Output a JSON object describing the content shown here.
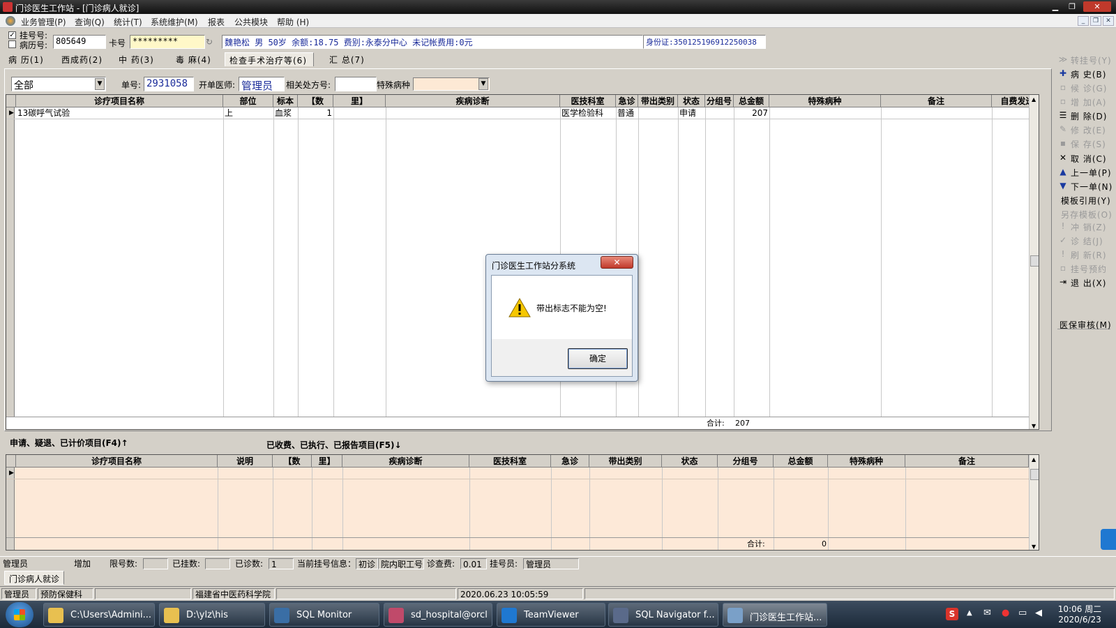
{
  "window": {
    "title": "门诊医生工作站 - [门诊病人就诊]"
  },
  "menu": [
    "业务管理(P)",
    "查询(Q)",
    "统计(T)",
    "系统维护(M)",
    "报表",
    "公共模块",
    "帮助 (H)"
  ],
  "patient": {
    "reg_label": "挂号号:",
    "record_label": "病历号:",
    "reg_value": "805649",
    "card_label": "卡号",
    "card_value": "*********",
    "info": "魏艳松 男 50岁 余额:18.75 费别:永泰分中心 未记帐费用:0元",
    "id_card": "身份证:350125196912250038"
  },
  "tabs": [
    "病 历(1)",
    "西成药(2)",
    "中 药(3)",
    "毒 麻(4)",
    "检查手术治疗等(6)",
    "汇 总(7)"
  ],
  "filter": {
    "category": "全部",
    "order_label": "单号:",
    "order_value": "2931058",
    "doctor_label": "开单医师:",
    "doctor_value": "管理员",
    "rx_label": "相关处方号:",
    "disease_label": "特殊病种"
  },
  "top_grid": {
    "headers": [
      "诊疗项目名称",
      "部位",
      "标本",
      "【数",
      "里】",
      "疾病诊断",
      "医技科室",
      "急诊",
      "带出类别",
      "状态",
      "分组号",
      "总金额",
      "特殊病种",
      "备注",
      "自费发送"
    ],
    "row": [
      "13碳呼气试验",
      "上",
      "血浆",
      "1",
      "",
      "",
      "医学检验科",
      "普通",
      "",
      "申请",
      "",
      "207",
      "",
      "",
      ""
    ],
    "total_label": "合计:",
    "total_value": "207"
  },
  "sections": {
    "top": "申请、疑退、已计价项目(F4)↑",
    "bottom": "已收费、已执行、已报告项目(F5)↓"
  },
  "bottom_grid": {
    "headers": [
      "诊疗项目名称",
      "说明",
      "【数",
      "里】",
      "疾病诊断",
      "医技科室",
      "急诊",
      "带出类别",
      "状态",
      "分组号",
      "总金额",
      "特殊病种",
      "备注"
    ],
    "total_label": "合计:",
    "total_value": "0"
  },
  "side_buttons": [
    {
      "label": "转挂号(Y)",
      "icon": "≫",
      "enabled": false
    },
    {
      "label": "病  史(B)",
      "icon": "✚",
      "enabled": true
    },
    {
      "label": "候  诊(G)",
      "icon": "▫",
      "enabled": false
    },
    {
      "label": "增  加(A)",
      "icon": "▫",
      "enabled": false
    },
    {
      "label": "删  除(D)",
      "icon": "☰",
      "enabled": true
    },
    {
      "label": "修  改(E)",
      "icon": "✎",
      "enabled": false
    },
    {
      "label": "保  存(S)",
      "icon": "▪",
      "enabled": false
    },
    {
      "label": "取  消(C)",
      "icon": "✕",
      "enabled": true
    },
    {
      "label": "上一单(P)",
      "icon": "▲",
      "enabled": true
    },
    {
      "label": "下一单(N)",
      "icon": "▼",
      "enabled": true
    },
    {
      "label": "模板引用(Y)",
      "icon": "",
      "enabled": true
    },
    {
      "label": "另存模板(O)",
      "icon": "",
      "enabled": false
    },
    {
      "label": "冲  销(Z)",
      "icon": "!",
      "enabled": false
    },
    {
      "label": "诊  结(J)",
      "icon": "✓",
      "enabled": false
    },
    {
      "label": "刷  新(R)",
      "icon": "!",
      "enabled": false
    },
    {
      "label": "挂号预约",
      "icon": "▫",
      "enabled": false
    },
    {
      "label": "退  出(X)",
      "icon": "⇥",
      "enabled": true
    }
  ],
  "side_extra": "医保审核(M)",
  "status1": {
    "user": "管理员",
    "mode": "增加",
    "limit_label": "限号数:",
    "limit": "",
    "registered_label": "已挂数:",
    "registered": "",
    "visited_label": "已诊数:",
    "visited": "1",
    "current_label": "当前挂号信息：",
    "visit_type": "初诊",
    "staff": "院内职工号",
    "fee_label": "诊查费:",
    "fee": "0.01",
    "registrar_label": "挂号员:",
    "registrar": "管理员"
  },
  "window_tab": "门诊病人就诊",
  "status2": {
    "user": "管理员",
    "dept": "预防保健科",
    "org": "福建省中医药科学院",
    "datetime": "2020.06.23 10:05:59"
  },
  "dialog": {
    "title": "门诊医生工作站分系统",
    "message": "带出标志不能为空!",
    "ok": "确定"
  },
  "taskbar": [
    {
      "label": "C:\\Users\\Admini...",
      "icon": "folder-icon",
      "color": "#e8c050"
    },
    {
      "label": "D:\\ylz\\his",
      "icon": "folder-icon",
      "color": "#e8c050"
    },
    {
      "label": "SQL Monitor",
      "icon": "sql-monitor-icon",
      "color": "#3a6ea5"
    },
    {
      "label": "sd_hospital@orcl",
      "icon": "database-icon",
      "color": "#c04a6a"
    },
    {
      "label": "TeamViewer",
      "icon": "teamviewer-icon",
      "color": "#1f78d1"
    },
    {
      "label": "SQL Navigator f...",
      "icon": "navigator-icon",
      "color": "#5a6a8a"
    },
    {
      "label": "门诊医生工作站...",
      "icon": "app-icon",
      "color": "#7aa0c8"
    }
  ],
  "clock": {
    "time": "10:06 周二",
    "date": "2020/6/23"
  }
}
